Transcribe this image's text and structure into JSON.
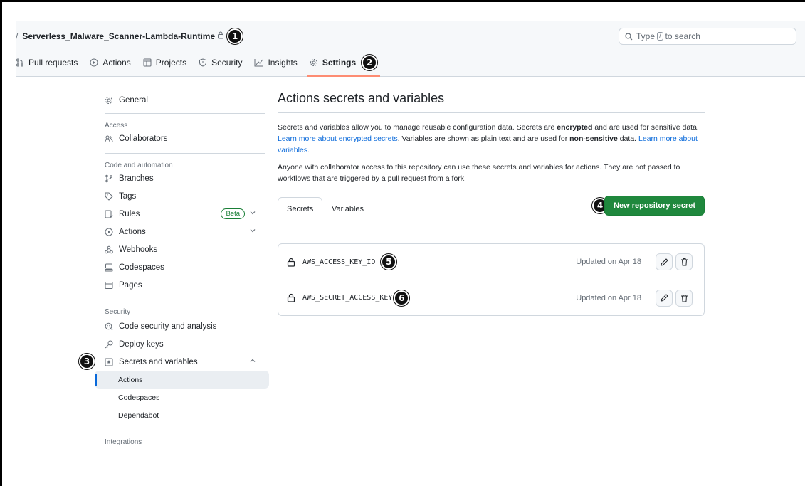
{
  "header": {
    "repo_prefix": "/",
    "repo_name": "Serverless_Malware_Scanner-Lambda-Runtime",
    "search_placeholder_pre": "Type",
    "search_key": "/",
    "search_placeholder_post": "to search",
    "search_edge": "X",
    "tabs": [
      {
        "label": "Pull requests",
        "icon": "pull-request-icon"
      },
      {
        "label": "Actions",
        "icon": "play-icon"
      },
      {
        "label": "Projects",
        "icon": "table-icon"
      },
      {
        "label": "Security",
        "icon": "shield-icon"
      },
      {
        "label": "Insights",
        "icon": "graph-icon"
      },
      {
        "label": "Settings",
        "icon": "gear-icon",
        "active": true
      }
    ]
  },
  "badges": [
    "1",
    "2",
    "3",
    "4",
    "5",
    "6"
  ],
  "sidebar": {
    "general": "General",
    "access_heading": "Access",
    "collaborators": "Collaborators",
    "code_heading": "Code and automation",
    "branches": "Branches",
    "tags": "Tags",
    "rules": "Rules",
    "rules_badge": "Beta",
    "actions": "Actions",
    "webhooks": "Webhooks",
    "codespaces": "Codespaces",
    "pages": "Pages",
    "security_heading": "Security",
    "code_security": "Code security and analysis",
    "deploy_keys": "Deploy keys",
    "secrets": "Secrets and variables",
    "sub_actions": "Actions",
    "sub_codespaces": "Codespaces",
    "sub_dependabot": "Dependabot",
    "integrations_heading": "Integrations"
  },
  "main": {
    "title": "Actions secrets and variables",
    "p1_a": "Secrets and variables allow you to manage reusable configuration data. Secrets are ",
    "p1_b": "encrypted",
    "p1_c": " and are used for sensitive data. ",
    "p1_link1": "Learn more about encrypted secrets",
    "p1_d": ". Variables are shown as plain text and are used for ",
    "p1_e": "non-sensitive",
    "p1_f": " data. ",
    "p1_link2": "Learn more about variables",
    "p1_g": ".",
    "p2": "Anyone with collaborator access to this repository can use these secrets and variables for actions. They are not passed to workflows that are triggered by a pull request from a fork.",
    "tab_secrets": "Secrets",
    "tab_variables": "Variables",
    "new_button": "New repository secret",
    "secrets": [
      {
        "name": "AWS_ACCESS_KEY_ID",
        "updated": "Updated on Apr 18"
      },
      {
        "name": "AWS_SECRET_ACCESS_KEY",
        "updated": "Updated on Apr 18"
      }
    ]
  },
  "colors": {
    "primary_button": "#1f883d",
    "link": "#0969da",
    "active_tab_underline": "#fd8c73"
  }
}
